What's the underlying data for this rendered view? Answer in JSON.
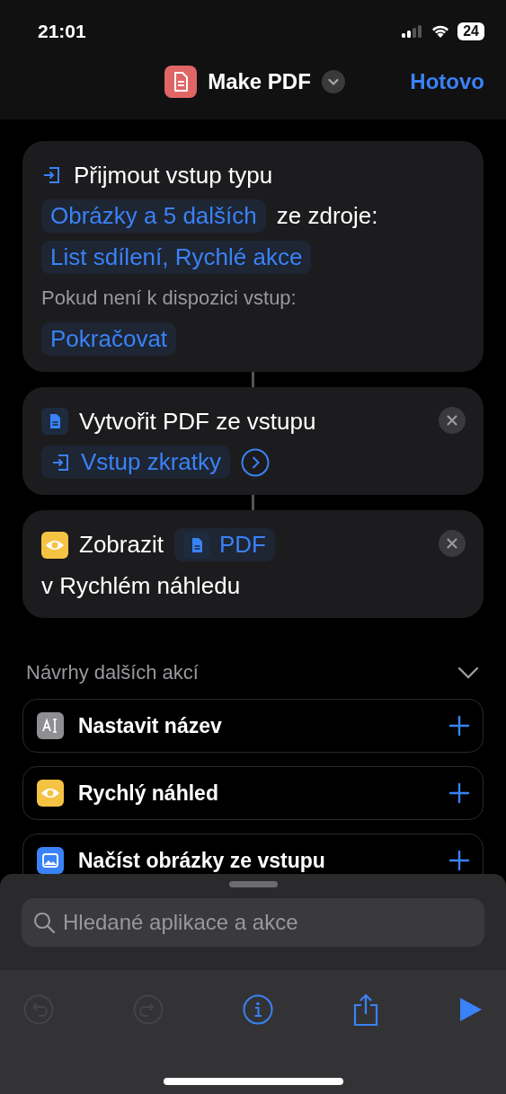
{
  "status_bar": {
    "time": "21:01",
    "battery": "24"
  },
  "nav": {
    "title": "Make PDF",
    "done": "Hotovo"
  },
  "actions": [
    {
      "removable": false,
      "lines": [
        [
          {
            "kind": "input_icon"
          },
          {
            "kind": "title",
            "text": "Přijmout vstup typu"
          }
        ],
        [
          {
            "kind": "token",
            "text": "Obrázky a 5 dalších"
          },
          {
            "kind": "text",
            "text": "ze zdroje:"
          }
        ],
        [
          {
            "kind": "token",
            "text": "List sdílení, Rychlé akce"
          }
        ],
        [
          {
            "kind": "muted",
            "text": "Pokud není k dispozici vstup:"
          }
        ],
        [
          {
            "kind": "token",
            "text": "Pokračovat"
          }
        ]
      ]
    },
    {
      "removable": true,
      "lines": [
        [
          {
            "kind": "doc_icon"
          },
          {
            "kind": "title",
            "text": "Vytvořit PDF ze vstupu"
          }
        ],
        [
          {
            "kind": "input_token",
            "text": "Vstup zkratky"
          },
          {
            "kind": "more"
          }
        ]
      ]
    },
    {
      "removable": true,
      "lines": [
        [
          {
            "kind": "eye_icon"
          },
          {
            "kind": "title",
            "text": "Zobrazit"
          },
          {
            "kind": "doc_token",
            "text": "PDF"
          }
        ],
        [
          {
            "kind": "title",
            "text": "v Rychlém náhledu"
          }
        ]
      ]
    }
  ],
  "suggestions": {
    "title": "Návrhy dalších akcí",
    "expanded": true,
    "items": [
      {
        "kind": "text",
        "color": "#8e8e93",
        "label": "Nastavit název"
      },
      {
        "kind": "eye",
        "color": "#f5c344",
        "label": "Rychlý náhled"
      },
      {
        "kind": "image",
        "color": "#3a82f7",
        "label": "Načíst obrázky ze vstupu"
      }
    ]
  },
  "search": {
    "placeholder": "Hledané aplikace a akce"
  },
  "toolbar": [
    {
      "kind": "undo",
      "disabled": true
    },
    {
      "kind": "redo",
      "disabled": true
    },
    {
      "kind": "info",
      "disabled": false
    },
    {
      "kind": "share",
      "disabled": false
    },
    {
      "kind": "run",
      "disabled": false
    }
  ]
}
